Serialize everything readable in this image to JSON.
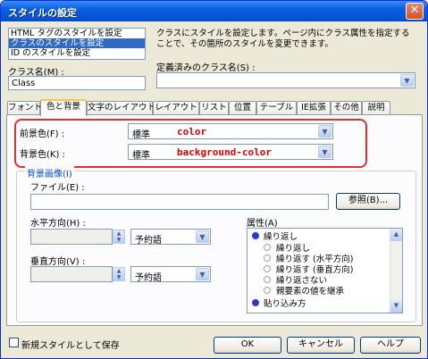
{
  "window": {
    "title": "スタイルの設定",
    "close": "✕"
  },
  "style_list": {
    "items": [
      "HTML タグのスタイルを設定",
      "クラスのスタイルを設定",
      "ID のスタイルを設定"
    ],
    "selected_index": 1
  },
  "description": "クラスにスタイルを設定します。ページ内にクラス属性を指定することで、その箇所のスタイルを変更できます。",
  "class_name": {
    "label": "クラス名(M) :",
    "value": "Class"
  },
  "defined_classes": {
    "label": "定義済みのクラス名(S) :",
    "value": ""
  },
  "tabs": [
    "フォント",
    "色と背景",
    "文字のレイアウト",
    "レイアウト",
    "リスト",
    "位置",
    "テーブル",
    "IE拡張",
    "その他",
    "説明"
  ],
  "active_tab": 1,
  "colors": {
    "foreground": {
      "label": "前景色(F) :",
      "value": "標準",
      "annotation": "color"
    },
    "background": {
      "label": "背景色(K) :",
      "value": "標準",
      "annotation": "background-color"
    }
  },
  "bg_image": {
    "group_label": "背景画像(I)",
    "file_label": "ファイル(E) :",
    "file_value": "",
    "browse_button": "参照(B)...",
    "horizontal_label": "水平方向(H) :",
    "horizontal_unit": "予約語",
    "vertical_label": "垂直方向(V) :",
    "vertical_unit": "予約語",
    "attributes_label": "属性(A)",
    "attributes": [
      {
        "text": "繰り返し",
        "level": 0,
        "radio": "on"
      },
      {
        "text": "繰り返し",
        "level": 1,
        "radio": "off"
      },
      {
        "text": "繰り返す (水平方向)",
        "level": 1,
        "radio": "off"
      },
      {
        "text": "繰り返す (垂直方向)",
        "level": 1,
        "radio": "off"
      },
      {
        "text": "繰り返さない",
        "level": 1,
        "radio": "off"
      },
      {
        "text": "親要素の値を継承",
        "level": 1,
        "radio": "off"
      },
      {
        "text": "貼り込み方",
        "level": 0,
        "radio": "on"
      }
    ]
  },
  "footer": {
    "new_style_checkbox": "新規スタイルとして保存",
    "ok": "OK",
    "cancel": "キャンセル",
    "help": "ヘルプ"
  },
  "accent_colors": {
    "annotation_red": "#e00000",
    "selection_blue": "#316ac5",
    "titlebar_blue": "#0554d6"
  }
}
